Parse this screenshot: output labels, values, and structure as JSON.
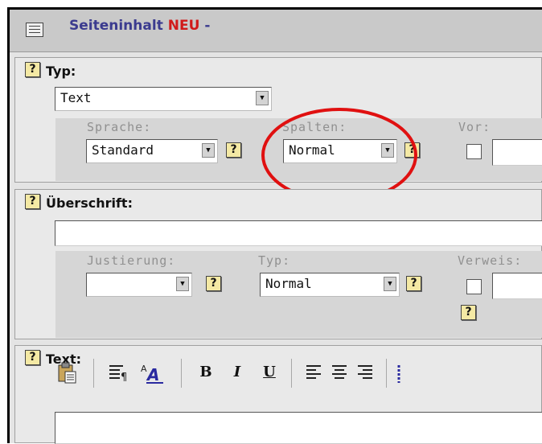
{
  "header": {
    "title": "Seiteninhalt",
    "neu": "NEU",
    "dash": "-"
  },
  "help_glyph": "?",
  "typ": {
    "title": "Typ:",
    "select_value": "Text",
    "sprache_label": "Sprache:",
    "sprache_value": "Standard",
    "spalten_label": "Spalten:",
    "spalten_value": "Normal",
    "vor_label": "Vor:"
  },
  "ueberschrift": {
    "title": "Überschrift:",
    "justierung_label": "Justierung:",
    "typ_label": "Typ:",
    "typ_value": "Normal",
    "verweis_label": "Verweis:"
  },
  "text_section": {
    "title": "Text:",
    "toolbar": {
      "paste_icon": "paste-icon",
      "paragraph_icon": "paragraph-format-icon",
      "font_icon": "font-size-icon",
      "bold_label": "B",
      "italic_label": "I",
      "underline_label": "U",
      "align_left_icon": "align-left-icon",
      "align_center_icon": "align-center-icon",
      "align_right_icon": "align-right-icon"
    }
  },
  "annotation_color": "#e01010"
}
